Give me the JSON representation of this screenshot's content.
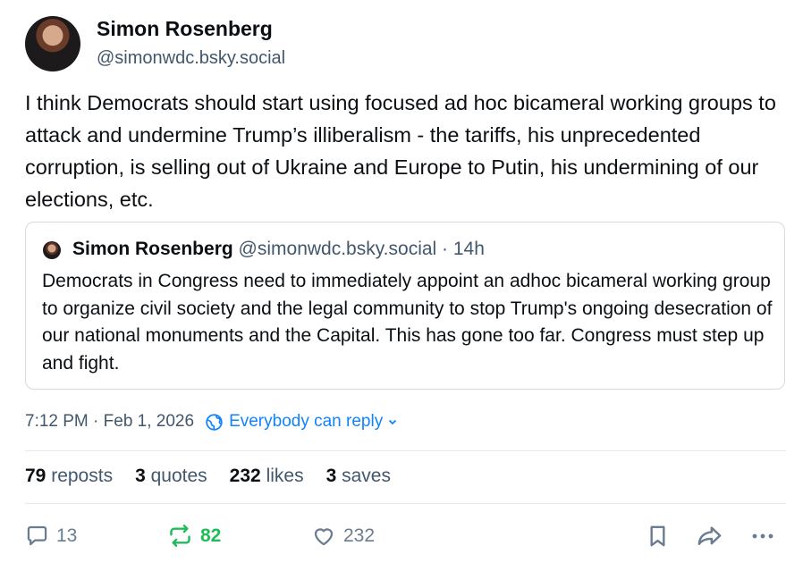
{
  "author": {
    "display_name": "Simon Rosenberg",
    "handle": "@simonwdc.bsky.social"
  },
  "post": {
    "text": "I think Democrats should start using focused ad hoc bicameral working groups to attack and undermine Trump’s illiberalism - the tariffs, his unprecedented corruption, is selling out of Ukraine and Europe to Putin, his undermining of our elections, etc."
  },
  "quote": {
    "display_name": "Simon Rosenberg",
    "handle_time": "@simonwdc.bsky.social · 14h",
    "text": "Democrats in Congress need to immediately appoint an adhoc bicameral working group to organize civil society and the legal community to stop Trump's ongoing desecration of our national monuments and the Capital.  This has gone too far.  Congress must step up and fight."
  },
  "meta": {
    "timestamp": "7:12 PM · Feb 1, 2026",
    "reply_setting": "Everybody can reply"
  },
  "stats": {
    "reposts_count": "79",
    "reposts_label": "reposts",
    "quotes_count": "3",
    "quotes_label": "quotes",
    "likes_count": "232",
    "likes_label": "likes",
    "saves_count": "3",
    "saves_label": "saves"
  },
  "actions": {
    "reply_count": "13",
    "repost_count": "82",
    "like_count": "232",
    "icons": [
      "reply-icon",
      "repost-icon",
      "like-icon",
      "bookmark-icon",
      "share-icon",
      "more-icon"
    ]
  },
  "colors": {
    "accent": "#1083fe",
    "repost_active": "#20bc5a",
    "muted_text": "#42576c",
    "border": "#d4dbe2"
  }
}
